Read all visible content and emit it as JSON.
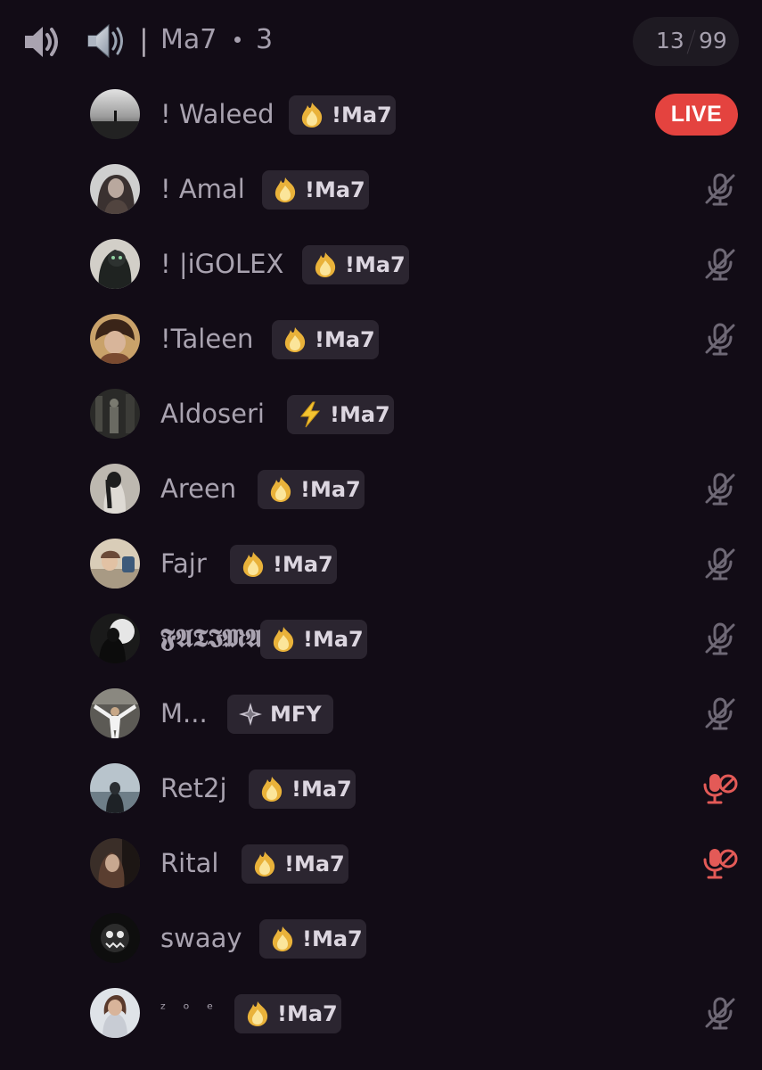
{
  "channel": {
    "separator": "|",
    "name": "Ma7",
    "user_count": "3",
    "limit_current": "13",
    "limit_max": "99",
    "speaker_icon": "speaker-icon",
    "channel_icon": "speaker-emoji-icon"
  },
  "colors": {
    "background": "#120c16",
    "text_muted": "#a9a3b0",
    "tag_bg": "#2b2530",
    "live_red": "#e4433f",
    "muted_icon": "#6e6875",
    "deafened_icon": "#e35a57"
  },
  "members": [
    {
      "name": "! Waleed",
      "tag": "!Ma7",
      "tag_icon": "fire-icon",
      "status": "live",
      "status_label": "LIVE"
    },
    {
      "name": "! Amal",
      "tag": "!Ma7",
      "tag_icon": "fire-icon",
      "status": "muted"
    },
    {
      "name": "! |iGOLEX",
      "tag": "!Ma7",
      "tag_icon": "fire-icon",
      "status": "muted"
    },
    {
      "name": "!Taleen",
      "tag": "!Ma7",
      "tag_icon": "fire-icon",
      "status": "muted"
    },
    {
      "name": "Aldoseri",
      "tag": "!Ma7",
      "tag_icon": "lightning-icon",
      "status": "none"
    },
    {
      "name": "Areen",
      "tag": "!Ma7",
      "tag_icon": "fire-icon",
      "status": "muted"
    },
    {
      "name": "Fajr",
      "tag": "!Ma7",
      "tag_icon": "fire-icon",
      "status": "muted"
    },
    {
      "name": "𝕱𝕬𝕿𝕴𝕸𝕬",
      "tag": "!Ma7",
      "tag_icon": "fire-icon",
      "status": "muted"
    },
    {
      "name": "M...",
      "tag": "MFY",
      "tag_icon": "sparkle-diamond-icon",
      "status": "muted"
    },
    {
      "name": "Ret2j",
      "tag": "!Ma7",
      "tag_icon": "fire-icon",
      "status": "server-muted"
    },
    {
      "name": "Rital",
      "tag": "!Ma7",
      "tag_icon": "fire-icon",
      "status": "server-muted"
    },
    {
      "name": "swaay",
      "tag": "!Ma7",
      "tag_icon": "fire-icon",
      "status": "none"
    },
    {
      "name": "ᶻ ᵒ ᵉ",
      "tag": "!Ma7",
      "tag_icon": "fire-icon",
      "status": "muted"
    }
  ]
}
